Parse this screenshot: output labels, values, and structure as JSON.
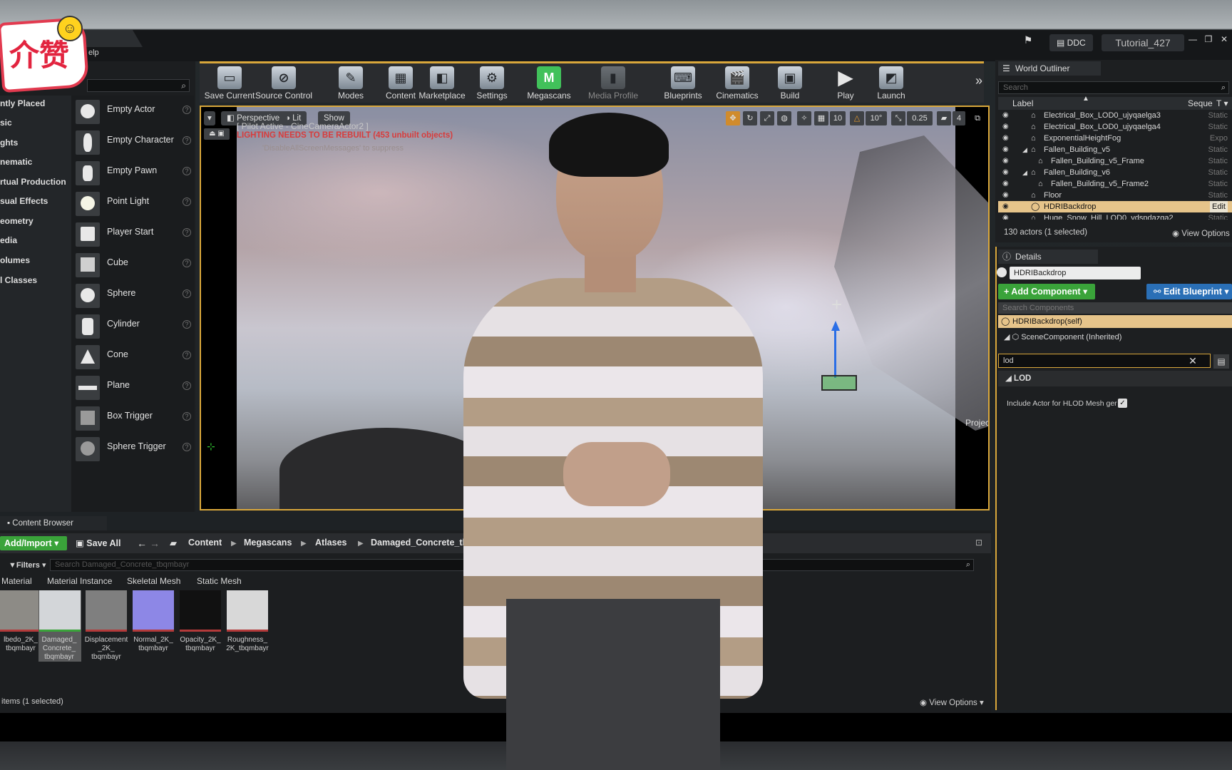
{
  "titlebar": {
    "help_label": "elp",
    "ddc_label": "DDC",
    "project_name": "Tutorial_427"
  },
  "place_panel": {
    "categories": [
      "ntly Placed",
      "sic",
      "ghts",
      "nematic",
      "rtual Production",
      "sual Effects",
      "eometry",
      "edia",
      "olumes",
      "l Classes"
    ],
    "items": [
      "Empty Actor",
      "Empty Character",
      "Empty Pawn",
      "Point Light",
      "Player Start",
      "Cube",
      "Sphere",
      "Cylinder",
      "Cone",
      "Plane",
      "Box Trigger",
      "Sphere Trigger"
    ]
  },
  "toolbar": {
    "tools": [
      {
        "label": "Save Current",
        "icon": "save-icon"
      },
      {
        "label": "Source Control",
        "icon": "source-control-icon"
      },
      {
        "label": "Modes",
        "icon": "modes-icon"
      },
      {
        "label": "Content",
        "icon": "content-icon"
      },
      {
        "label": "Marketplace",
        "icon": "marketplace-icon"
      },
      {
        "label": "Settings",
        "icon": "settings-icon"
      },
      {
        "label": "Megascans",
        "icon": "megascans-icon"
      },
      {
        "label": "Media Profile",
        "icon": "media-profile-icon"
      },
      {
        "label": "Blueprints",
        "icon": "blueprints-icon"
      },
      {
        "label": "Cinematics",
        "icon": "cinematics-icon"
      },
      {
        "label": "Build",
        "icon": "build-icon"
      },
      {
        "label": "Play",
        "icon": "play-icon"
      },
      {
        "label": "Launch",
        "icon": "launch-icon"
      }
    ]
  },
  "viewport": {
    "perspective": "Perspective",
    "lit": "Lit",
    "show": "Show",
    "grid_snap": "10",
    "rot_snap": "10°",
    "scale_snap": "0.25",
    "cam_speed": "4",
    "pilot": "[ Pilot Active - CineCameraActor2 ]",
    "lighting_warning": "LIGHTING NEEDS TO BE REBUILT (453 unbuilt objects)",
    "disable_msg": "'DisableAllScreenMessages' to suppress",
    "side_label": "Projec"
  },
  "outliner": {
    "tab": "World Outliner",
    "search_placeholder": "Search",
    "col_label": "Label",
    "col_type": "Seque",
    "rows": [
      {
        "label": "Electrical_Box_LOD0_ujyqaelga3",
        "type": "Static"
      },
      {
        "label": "Electrical_Box_LOD0_ujyqaelga4",
        "type": "Static"
      },
      {
        "label": "ExponentialHeightFog",
        "type": "Expo"
      },
      {
        "label": "Fallen_Building_v5",
        "type": "Static"
      },
      {
        "label": "Fallen_Building_v5_Frame",
        "type": "Static"
      },
      {
        "label": "Fallen_Building_v6",
        "type": "Static"
      },
      {
        "label": "Fallen_Building_v5_Frame2",
        "type": "Static"
      },
      {
        "label": "Floor",
        "type": "Static"
      },
      {
        "label": "HDRIBackdrop",
        "type": "Edit"
      },
      {
        "label": "Huge_Snow_Hill_LOD0_vdspdazga2",
        "type": "Static"
      }
    ],
    "actor_count": "130 actors (1 selected)",
    "view_options": "View Options"
  },
  "details": {
    "tab": "Details",
    "actor_name": "HDRIBackdrop",
    "add_component": "+ Add Component",
    "edit_blueprint": "Edit Blueprint",
    "search_components_placeholder": "Search Components",
    "comp_self": "HDRIBackdrop(self)",
    "comp_scene": "SceneComponent (Inherited)",
    "filter_value": "lod",
    "section": "LOD",
    "property": "Include Actor for HLOD Mesh ger"
  },
  "content_browser": {
    "tab": "Content Browser",
    "add_import": "Add/Import",
    "save_all": "Save All",
    "breadcrumbs": [
      "Content",
      "Megascans",
      "Atlases",
      "Damaged_Concrete_tbqmbayr"
    ],
    "filters": "Filters",
    "search_placeholder": "Search Damaged_Concrete_tbqmbayr",
    "filter_tabs": [
      "Material",
      "Material Instance",
      "Skeletal Mesh",
      "Static Mesh"
    ],
    "assets": [
      {
        "name": "lbedo_2K_ tbqmbayr",
        "color": "#8d8b86"
      },
      {
        "name": "Damaged_ Concrete_ tbqmbayr",
        "color": "#d3d6d9"
      },
      {
        "name": "Displacement _2K_ tbqmbayr",
        "color": "#7f7f7f"
      },
      {
        "name": "Normal_2K_ tbqmbayr",
        "color": "#8d87e6"
      },
      {
        "name": "Opacity_2K_ tbqmbayr",
        "color": "#111111"
      },
      {
        "name": "Roughness_ 2K_tbqmbayr",
        "color": "#d8d8d8"
      }
    ],
    "item_count": "items (1 selected)",
    "view_options": "View Options"
  },
  "sticker": {
    "text": "介赞"
  }
}
